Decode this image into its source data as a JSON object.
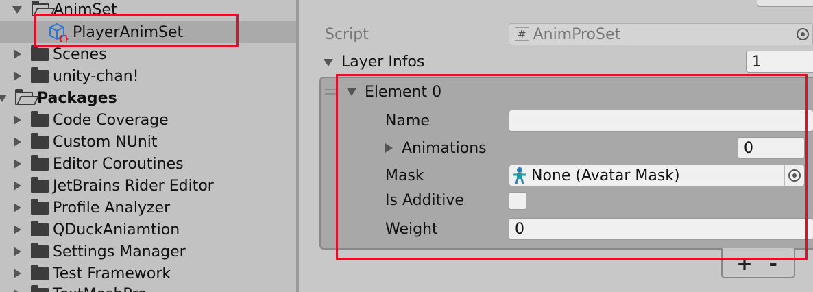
{
  "project": {
    "items": [
      {
        "label": "AnimSet",
        "state": "expanded"
      },
      {
        "label": "PlayerAnimSet",
        "state": "asset"
      },
      {
        "label": "Scenes",
        "state": "collapsed"
      },
      {
        "label": "unity-chan!",
        "state": "collapsed"
      },
      {
        "label": "Packages",
        "state": "expanded"
      },
      {
        "label": "Code Coverage",
        "state": "collapsed"
      },
      {
        "label": "Custom NUnit",
        "state": "collapsed"
      },
      {
        "label": "Editor Coroutines",
        "state": "collapsed"
      },
      {
        "label": "JetBrains Rider Editor",
        "state": "collapsed"
      },
      {
        "label": "Profile Analyzer",
        "state": "collapsed"
      },
      {
        "label": "QDuckAniamtion",
        "state": "collapsed"
      },
      {
        "label": "Settings Manager",
        "state": "collapsed"
      },
      {
        "label": "Test Framework",
        "state": "collapsed"
      },
      {
        "label": "TextMeshPro",
        "state": "collapsed"
      }
    ],
    "asset_icon_text": "{}"
  },
  "inspector": {
    "script_label": "Script",
    "script_value": "AnimProSet",
    "script_hash": "#",
    "layer_infos_label": "Layer Infos",
    "layer_infos_size": "1",
    "element": {
      "title": "Element 0",
      "name_label": "Name",
      "name_value": "",
      "animations_label": "Animations",
      "animations_size": "0",
      "mask_label": "Mask",
      "mask_value": "None (Avatar Mask)",
      "is_additive_label": "Is Additive",
      "weight_label": "Weight",
      "weight_value": "0"
    },
    "add_label": "+",
    "remove_label": "-"
  },
  "colors": {
    "highlight": "#e0102a",
    "selection": "#aaaaaa",
    "element_bg": "#a8a8a8"
  }
}
